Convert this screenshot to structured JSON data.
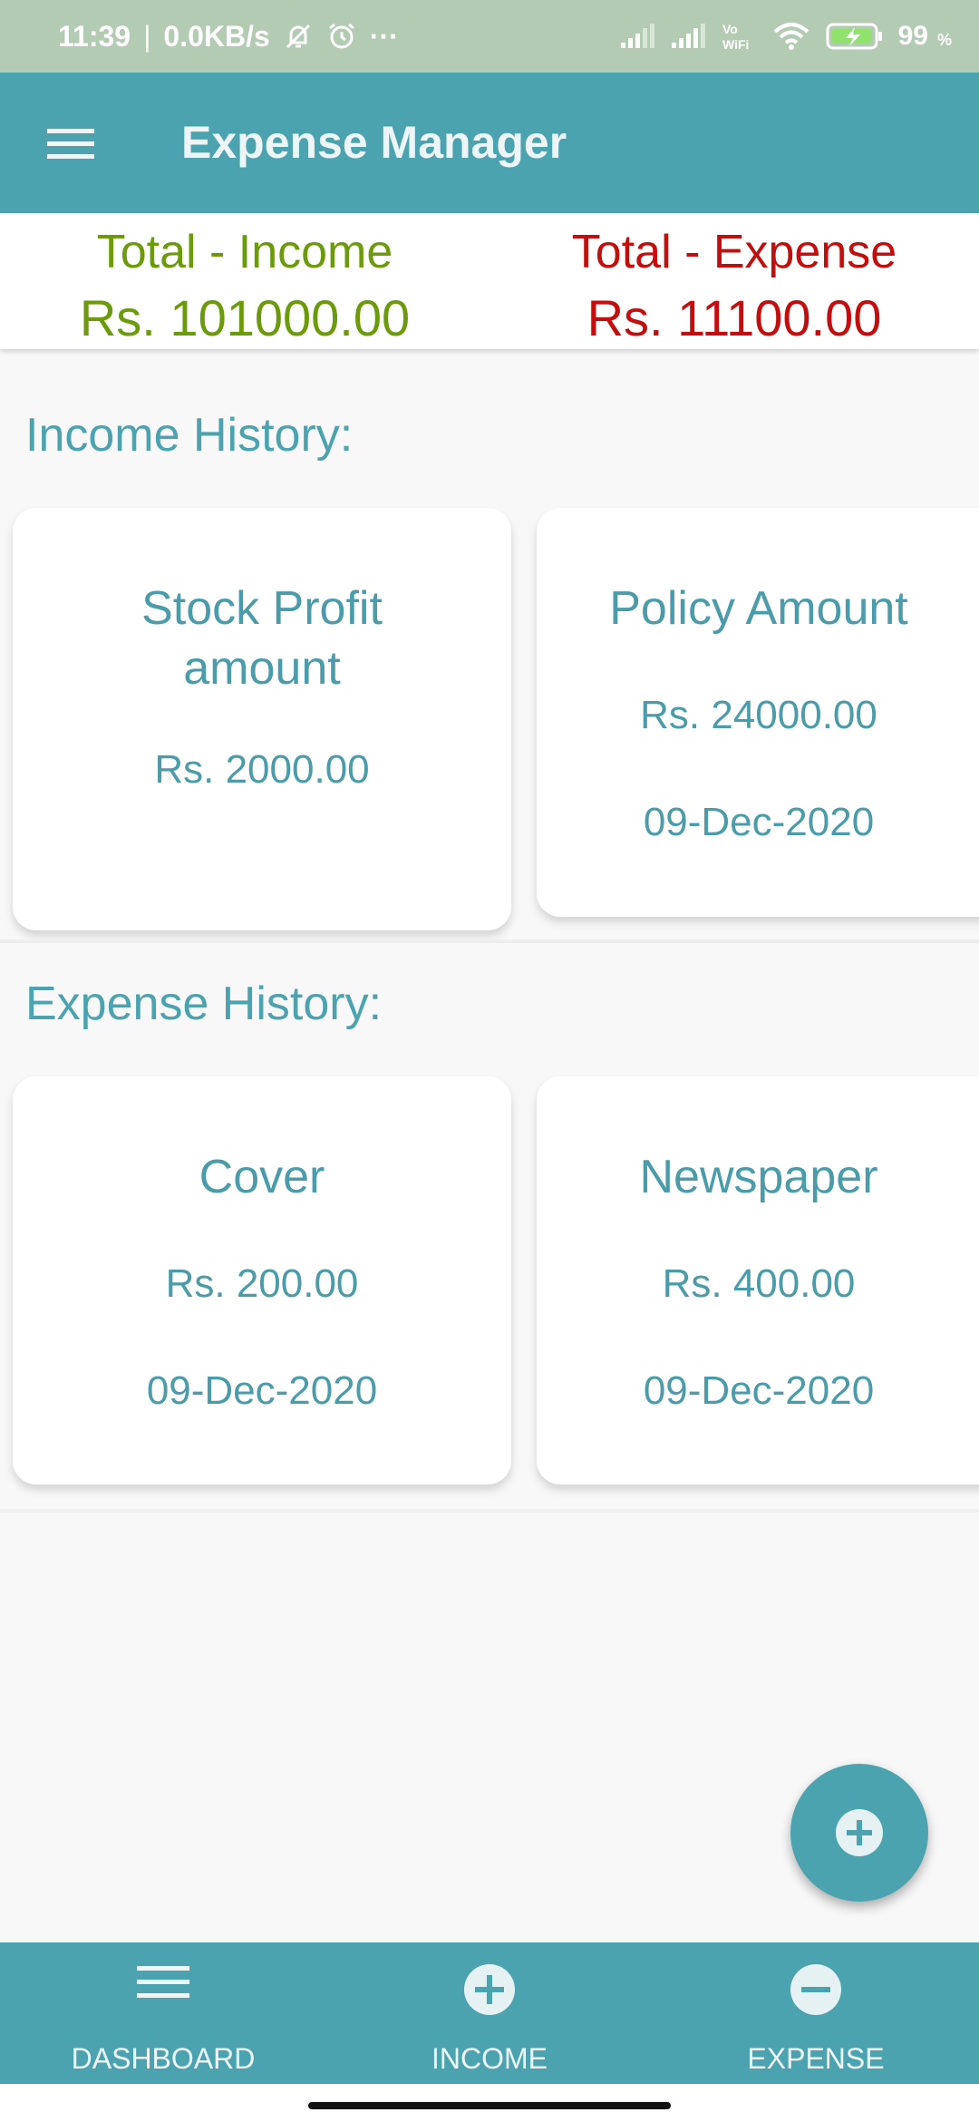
{
  "status_bar": {
    "time": "11:39",
    "separator": "|",
    "speed": "0.0KB/s",
    "more": "···",
    "battery": "99",
    "battery_unit": "%"
  },
  "app_bar": {
    "title": "Expense Manager",
    "menu_icon": "hamburger-icon"
  },
  "totals": {
    "income_label": "Total - Income",
    "income_value": "Rs. 101000.00",
    "expense_label": "Total - Expense",
    "expense_value": "Rs. 11100.00",
    "income_color": "#6b9a0a",
    "expense_color": "#c40e0e"
  },
  "income_history": {
    "title": "Income History:",
    "cards": [
      {
        "title_line1": "Stock Profit",
        "title_line2": "amount",
        "amount": "Rs. 2000.00"
      },
      {
        "title": "Policy Amount",
        "amount": "Rs. 24000.00",
        "date": "09-Dec-2020"
      }
    ]
  },
  "expense_history": {
    "title": "Expense History:",
    "cards": [
      {
        "title": "Cover",
        "amount": "Rs. 200.00",
        "date": "09-Dec-2020"
      },
      {
        "title": "Newspaper",
        "amount": "Rs. 400.00",
        "date": "09-Dec-2020"
      }
    ]
  },
  "fab": {
    "icon": "plus-icon"
  },
  "bottom_nav": {
    "items": [
      {
        "label": "DASHBOARD",
        "icon": "list-icon"
      },
      {
        "label": "INCOME",
        "icon": "plus-circle-icon"
      },
      {
        "label": "EXPENSE",
        "icon": "minus-circle-icon"
      }
    ]
  },
  "colors": {
    "primary": "#4ba3b0",
    "status_bar": "#b3cbb3"
  }
}
